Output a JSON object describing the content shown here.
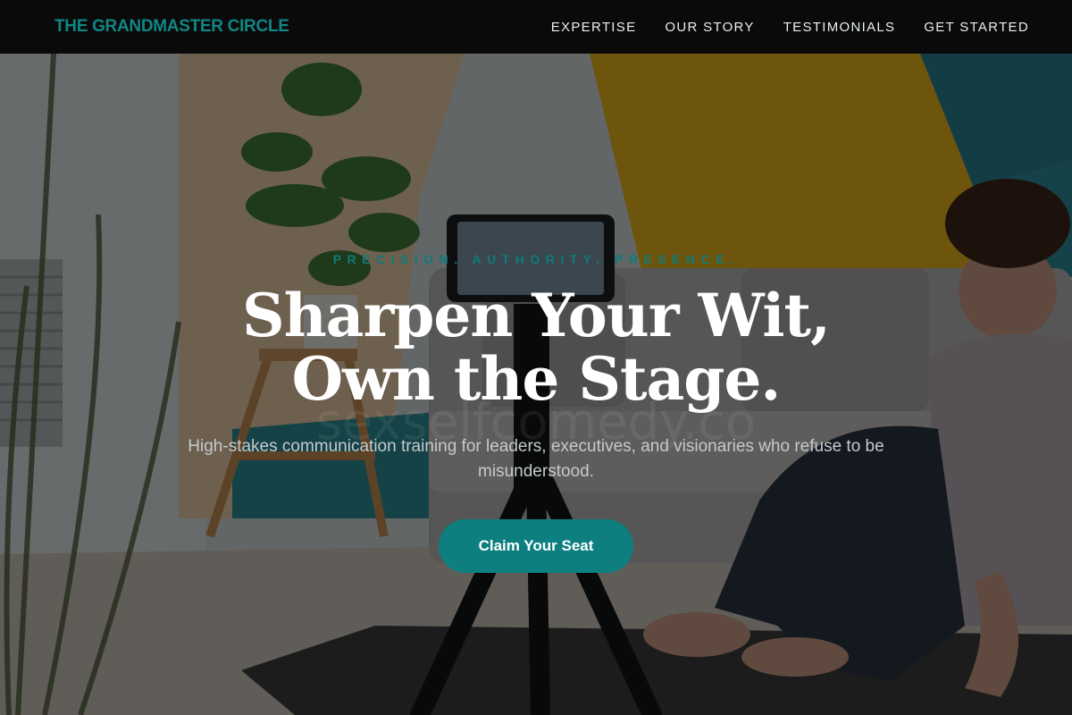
{
  "header": {
    "brand": "THE GRANDMASTER CIRCLE",
    "nav": [
      {
        "label": "EXPERTISE"
      },
      {
        "label": "OUR STORY"
      },
      {
        "label": "TESTIMONIALS"
      },
      {
        "label": "GET STARTED"
      }
    ]
  },
  "hero": {
    "tagline": "PRECISION. AUTHORITY. PRESENCE.",
    "headline_line1": "Sharpen Your Wit,",
    "headline_line2": "Own the Stage.",
    "subtext": "High-stakes communication training for leaders, executives, and visionaries who refuse to be misunderstood.",
    "cta_label": "Claim Your Seat",
    "watermark": "sexselfcomedy.co"
  },
  "colors": {
    "accent": "#0d7f80",
    "brand": "#0f8784",
    "header_bg": "#0a0a0a"
  }
}
